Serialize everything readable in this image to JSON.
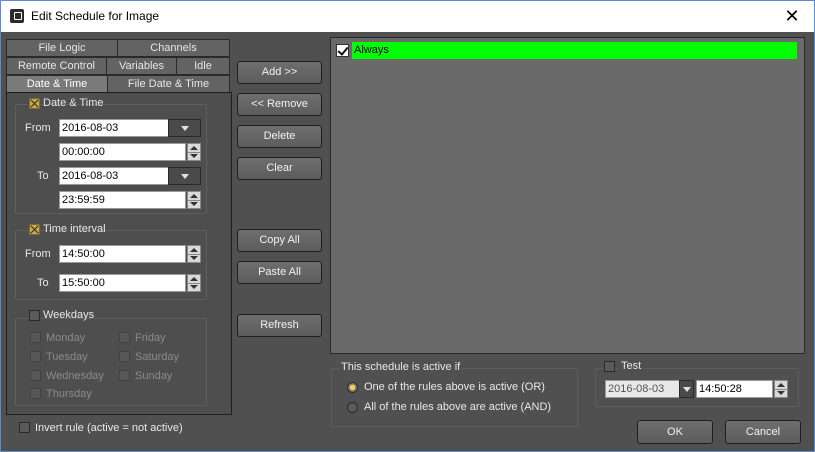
{
  "window": {
    "title": "Edit Schedule for Image",
    "close_glyph": "✕"
  },
  "tabs": {
    "row1": [
      "File Logic",
      "Channels"
    ],
    "row2": [
      "Remote Control",
      "Variables",
      "Idle"
    ],
    "row3": [
      "Date & Time",
      "File Date & Time"
    ],
    "active": "Date & Time"
  },
  "date_time": {
    "label": "Date & Time",
    "checked": true,
    "from_label": "From",
    "to_label": "To",
    "from_date": "2016-08-03",
    "from_time": "00:00:00",
    "to_date": "2016-08-03",
    "to_time": "23:59:59"
  },
  "time_interval": {
    "label": "Time interval",
    "checked": true,
    "from_label": "From",
    "to_label": "To",
    "from_time": "14:50:00",
    "to_time": "15:50:00"
  },
  "weekdays": {
    "label": "Weekdays",
    "checked": false,
    "days": [
      "Monday",
      "Tuesday",
      "Wednesday",
      "Thursday",
      "Friday",
      "Saturday",
      "Sunday"
    ]
  },
  "invert_rule": {
    "label": "Invert rule (active = not active)",
    "checked": false
  },
  "buttons": {
    "add": "Add >>",
    "remove": "<< Remove",
    "delete": "Delete",
    "clear": "Clear",
    "copy_all": "Copy All",
    "paste_all": "Paste All",
    "refresh": "Refresh",
    "ok": "OK",
    "cancel": "Cancel"
  },
  "rules_list": [
    {
      "label": "Always",
      "checked": true,
      "highlight": "#00ff00"
    }
  ],
  "active_if": {
    "label": "This schedule is active if",
    "options": [
      "One of the rules above is active (OR)",
      "All of the rules above are active (AND)"
    ],
    "selected": 0
  },
  "test": {
    "label": "Test",
    "checked": false,
    "date": "2016-08-03",
    "time": "14:50:28"
  },
  "colors": {
    "background": "#505050",
    "panel": "#4e4e4e",
    "highlight": "#00ff00",
    "check_accent": "#c9a94a"
  }
}
